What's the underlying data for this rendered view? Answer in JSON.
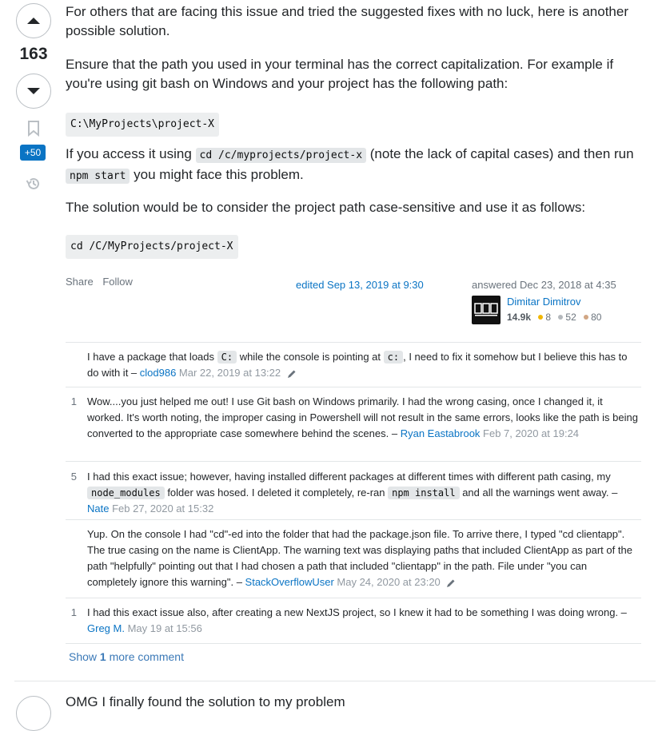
{
  "vote": {
    "count": "163"
  },
  "bounty": {
    "label": "+50"
  },
  "answer": {
    "p1": "For others that are facing this issue and tried the suggested fixes with no luck, here is another possible solution.",
    "p2": "Ensure that the path you used in your terminal has the correct capitalization. For example if you're using git bash on Windows and your project has the following path:",
    "code1": "C:\\MyProjects\\project-X",
    "p3_a": "If you access it using ",
    "p3_code1": "cd /c/myprojects/project-x",
    "p3_b": " (note the lack of capital cases) and then run ",
    "p3_code2": "npm start",
    "p3_c": " you might face this problem.",
    "p4": "The solution would be to consider the project path case-sensitive and use it as follows:",
    "code2": "cd /C/MyProjects/project-X"
  },
  "menu": {
    "share": "Share",
    "follow": "Follow"
  },
  "edited": "edited Sep 13, 2019 at 9:30",
  "answered": "answered Dec 23, 2018 at 4:35",
  "user": {
    "name": "Dimitar Dimitrov",
    "rep": "14.9k",
    "gold": "8",
    "silver": "52",
    "bronze": "80",
    "gold_color": "#f1b600",
    "silver_color": "#b4b8bc",
    "bronze_color": "#d1a684"
  },
  "comments": [
    {
      "score": "",
      "t1": "I have a package that loads ",
      "c1": "C:",
      "t2": " while the console is pointing at ",
      "c2": "c:",
      "t3": ", I need to fix it somehow but I believe this has to do with it – ",
      "user": "clod986",
      "date": " Mar 22, 2019 at 13:22"
    },
    {
      "score": "1",
      "text": "Wow....you just helped me out! I use Git bash on Windows primarily. I had the wrong casing, once I changed it, it worked. It's worth noting, the improper casing in Powershell will not result in the same errors, looks like the path is being converted to the appropriate case somewhere behind the scenes. – ",
      "user": "Ryan Eastabrook",
      "date": " Feb 7, 2020 at 19:24"
    },
    {
      "score": "5",
      "t1": "I had this exact issue; however, having installed different packages at different times with different path casing, my ",
      "c1": "node_modules",
      "t2": " folder was hosed. I deleted it completely, re-ran ",
      "c2": "npm install",
      "t3": " and all the warnings went away. – ",
      "user": "Nate",
      "date": " Feb 27, 2020 at 15:32"
    },
    {
      "score": "",
      "text": "Yup. On the console I had \"cd\"-ed into the folder that had the package.json file. To arrive there, I typed \"cd clientapp\". The true casing on the name is ClientApp. The warning text was displaying paths that included ClientApp as part of the path \"helpfully\" pointing out that I had chosen a path that included \"clientapp\" in the path. File under \"you can completely ignore this warning\". – ",
      "user": "StackOverflowUser",
      "date": " May 24, 2020 at 23:20"
    },
    {
      "score": "1",
      "text": "I had this exact issue also, after creating a new NextJS project, so I knew it had to be something I was doing wrong. – ",
      "user": "Greg M.",
      "date": " May 19 at 15:56"
    }
  ],
  "more": {
    "prefix": "Show ",
    "count": "1",
    "suffix": " more comment"
  },
  "next_answer": {
    "text": "OMG I finally found the solution to my problem"
  }
}
